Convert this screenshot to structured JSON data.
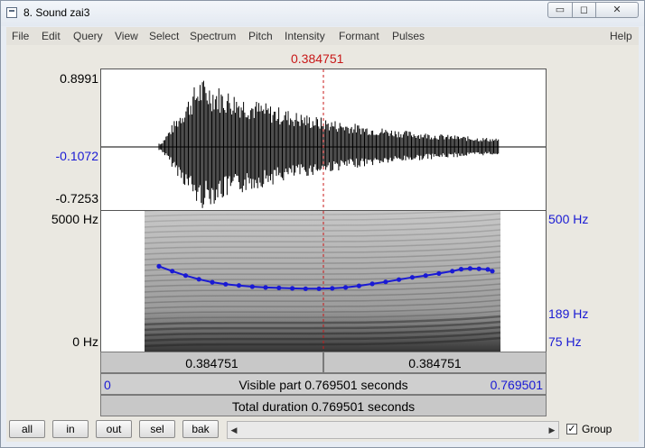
{
  "window": {
    "title": "8. Sound zai3",
    "min_glyph": "▭",
    "max_glyph": "◻",
    "close_glyph": "✕"
  },
  "menu": [
    "File",
    "Edit",
    "Query",
    "View",
    "Select",
    "Spectrum",
    "Pitch",
    "Intensity",
    "Formant",
    "Pulses",
    "Help"
  ],
  "cursor": {
    "time_label": "0.384751",
    "time_fraction": 0.5
  },
  "waveform": {
    "max_label": "0.8991",
    "zero_label": "-0.1072",
    "min_label": "-0.7253"
  },
  "spectrogram": {
    "top_freq_label": "5000 Hz",
    "bottom_freq_label": "0 Hz"
  },
  "pitch": {
    "top_label": "500 Hz",
    "mid_label": "189 Hz",
    "bottom_label": "75 Hz",
    "color": "#1a1ad4",
    "contour": [
      [
        0.13,
        237
      ],
      [
        0.16,
        222
      ],
      [
        0.19,
        209
      ],
      [
        0.22,
        199
      ],
      [
        0.25,
        191
      ],
      [
        0.28,
        186
      ],
      [
        0.31,
        183
      ],
      [
        0.34,
        180
      ],
      [
        0.37,
        178
      ],
      [
        0.4,
        177
      ],
      [
        0.43,
        176
      ],
      [
        0.46,
        175
      ],
      [
        0.49,
        175
      ],
      [
        0.52,
        176
      ],
      [
        0.55,
        178
      ],
      [
        0.58,
        182
      ],
      [
        0.61,
        187
      ],
      [
        0.64,
        192
      ],
      [
        0.67,
        198
      ],
      [
        0.7,
        204
      ],
      [
        0.73,
        209
      ],
      [
        0.76,
        215
      ],
      [
        0.79,
        222
      ],
      [
        0.81,
        228
      ],
      [
        0.83,
        230
      ],
      [
        0.85,
        229
      ],
      [
        0.87,
        227
      ],
      [
        0.88,
        222
      ]
    ]
  },
  "time_bars": {
    "left_selection": "0.384751",
    "right_selection": "0.384751",
    "visible_start": "0",
    "visible_text": "Visible part 0.769501 seconds",
    "visible_end": "0.769501",
    "total_text": "Total duration 0.769501 seconds"
  },
  "buttons": {
    "all": "all",
    "in": "in",
    "out": "out",
    "sel": "sel",
    "bak": "bak"
  },
  "scroll": {
    "left_arrow": "◀",
    "right_arrow": "▶"
  },
  "group": {
    "label": "Group",
    "checked_glyph": "✓"
  },
  "colors": {
    "cursor": "#c81818",
    "pitch": "#1a1ad4"
  }
}
